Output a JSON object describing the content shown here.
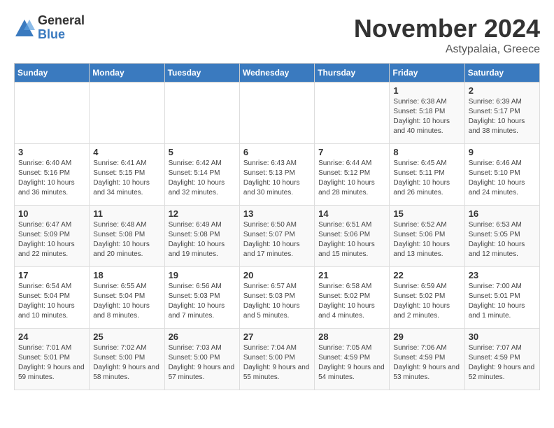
{
  "header": {
    "logo_general": "General",
    "logo_blue": "Blue",
    "month_title": "November 2024",
    "location": "Astypalaia, Greece"
  },
  "days_of_week": [
    "Sunday",
    "Monday",
    "Tuesday",
    "Wednesday",
    "Thursday",
    "Friday",
    "Saturday"
  ],
  "weeks": [
    [
      {
        "day": "",
        "detail": ""
      },
      {
        "day": "",
        "detail": ""
      },
      {
        "day": "",
        "detail": ""
      },
      {
        "day": "",
        "detail": ""
      },
      {
        "day": "",
        "detail": ""
      },
      {
        "day": "1",
        "detail": "Sunrise: 6:38 AM\nSunset: 5:18 PM\nDaylight: 10 hours and 40 minutes."
      },
      {
        "day": "2",
        "detail": "Sunrise: 6:39 AM\nSunset: 5:17 PM\nDaylight: 10 hours and 38 minutes."
      }
    ],
    [
      {
        "day": "3",
        "detail": "Sunrise: 6:40 AM\nSunset: 5:16 PM\nDaylight: 10 hours and 36 minutes."
      },
      {
        "day": "4",
        "detail": "Sunrise: 6:41 AM\nSunset: 5:15 PM\nDaylight: 10 hours and 34 minutes."
      },
      {
        "day": "5",
        "detail": "Sunrise: 6:42 AM\nSunset: 5:14 PM\nDaylight: 10 hours and 32 minutes."
      },
      {
        "day": "6",
        "detail": "Sunrise: 6:43 AM\nSunset: 5:13 PM\nDaylight: 10 hours and 30 minutes."
      },
      {
        "day": "7",
        "detail": "Sunrise: 6:44 AM\nSunset: 5:12 PM\nDaylight: 10 hours and 28 minutes."
      },
      {
        "day": "8",
        "detail": "Sunrise: 6:45 AM\nSunset: 5:11 PM\nDaylight: 10 hours and 26 minutes."
      },
      {
        "day": "9",
        "detail": "Sunrise: 6:46 AM\nSunset: 5:10 PM\nDaylight: 10 hours and 24 minutes."
      }
    ],
    [
      {
        "day": "10",
        "detail": "Sunrise: 6:47 AM\nSunset: 5:09 PM\nDaylight: 10 hours and 22 minutes."
      },
      {
        "day": "11",
        "detail": "Sunrise: 6:48 AM\nSunset: 5:08 PM\nDaylight: 10 hours and 20 minutes."
      },
      {
        "day": "12",
        "detail": "Sunrise: 6:49 AM\nSunset: 5:08 PM\nDaylight: 10 hours and 19 minutes."
      },
      {
        "day": "13",
        "detail": "Sunrise: 6:50 AM\nSunset: 5:07 PM\nDaylight: 10 hours and 17 minutes."
      },
      {
        "day": "14",
        "detail": "Sunrise: 6:51 AM\nSunset: 5:06 PM\nDaylight: 10 hours and 15 minutes."
      },
      {
        "day": "15",
        "detail": "Sunrise: 6:52 AM\nSunset: 5:06 PM\nDaylight: 10 hours and 13 minutes."
      },
      {
        "day": "16",
        "detail": "Sunrise: 6:53 AM\nSunset: 5:05 PM\nDaylight: 10 hours and 12 minutes."
      }
    ],
    [
      {
        "day": "17",
        "detail": "Sunrise: 6:54 AM\nSunset: 5:04 PM\nDaylight: 10 hours and 10 minutes."
      },
      {
        "day": "18",
        "detail": "Sunrise: 6:55 AM\nSunset: 5:04 PM\nDaylight: 10 hours and 8 minutes."
      },
      {
        "day": "19",
        "detail": "Sunrise: 6:56 AM\nSunset: 5:03 PM\nDaylight: 10 hours and 7 minutes."
      },
      {
        "day": "20",
        "detail": "Sunrise: 6:57 AM\nSunset: 5:03 PM\nDaylight: 10 hours and 5 minutes."
      },
      {
        "day": "21",
        "detail": "Sunrise: 6:58 AM\nSunset: 5:02 PM\nDaylight: 10 hours and 4 minutes."
      },
      {
        "day": "22",
        "detail": "Sunrise: 6:59 AM\nSunset: 5:02 PM\nDaylight: 10 hours and 2 minutes."
      },
      {
        "day": "23",
        "detail": "Sunrise: 7:00 AM\nSunset: 5:01 PM\nDaylight: 10 hours and 1 minute."
      }
    ],
    [
      {
        "day": "24",
        "detail": "Sunrise: 7:01 AM\nSunset: 5:01 PM\nDaylight: 9 hours and 59 minutes."
      },
      {
        "day": "25",
        "detail": "Sunrise: 7:02 AM\nSunset: 5:00 PM\nDaylight: 9 hours and 58 minutes."
      },
      {
        "day": "26",
        "detail": "Sunrise: 7:03 AM\nSunset: 5:00 PM\nDaylight: 9 hours and 57 minutes."
      },
      {
        "day": "27",
        "detail": "Sunrise: 7:04 AM\nSunset: 5:00 PM\nDaylight: 9 hours and 55 minutes."
      },
      {
        "day": "28",
        "detail": "Sunrise: 7:05 AM\nSunset: 4:59 PM\nDaylight: 9 hours and 54 minutes."
      },
      {
        "day": "29",
        "detail": "Sunrise: 7:06 AM\nSunset: 4:59 PM\nDaylight: 9 hours and 53 minutes."
      },
      {
        "day": "30",
        "detail": "Sunrise: 7:07 AM\nSunset: 4:59 PM\nDaylight: 9 hours and 52 minutes."
      }
    ]
  ]
}
